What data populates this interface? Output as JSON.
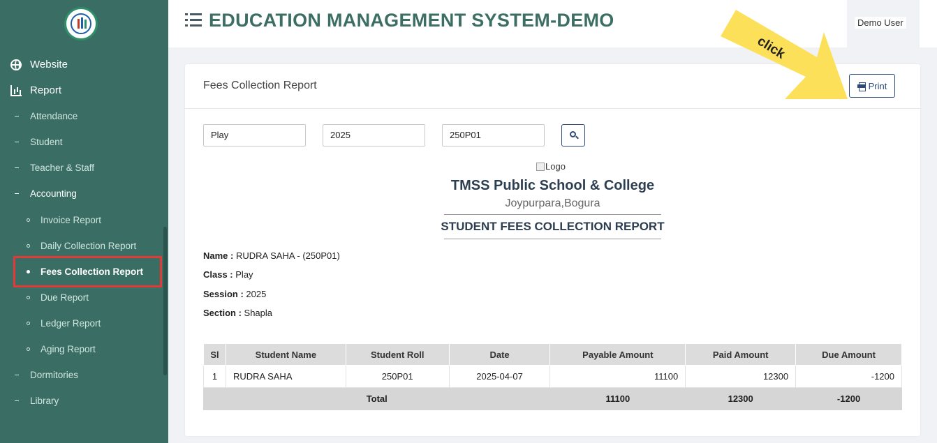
{
  "header": {
    "title": "EDUCATION MANAGEMENT SYSTEM-DEMO",
    "user": "Demo User"
  },
  "sidebar": {
    "top_items": [
      {
        "label": "Website",
        "icon": "globe-icon"
      },
      {
        "label": "Report",
        "icon": "bar-chart-icon"
      }
    ],
    "report_items": [
      {
        "label": "Attendance"
      },
      {
        "label": "Student"
      },
      {
        "label": "Teacher & Staff"
      },
      {
        "label": "Accounting"
      }
    ],
    "accounting_items": [
      {
        "label": "Invoice Report"
      },
      {
        "label": "Daily Collection Report"
      },
      {
        "label": "Fees Collection Report",
        "active": true
      },
      {
        "label": "Due Report"
      },
      {
        "label": "Ledger Report"
      },
      {
        "label": "Aging Report"
      }
    ],
    "bottom_items": [
      {
        "label": "Dormitories"
      },
      {
        "label": "Library"
      }
    ]
  },
  "card": {
    "title": "Fees Collection Report",
    "print_label": "Print"
  },
  "filters": {
    "class": "Play",
    "session": "2025",
    "student": "250P01"
  },
  "report": {
    "logo_alt": "Logo",
    "school_name": "TMSS Public School & College",
    "address": "Joypurpara,Bogura",
    "title": "STUDENT FEES COLLECTION REPORT",
    "info": {
      "name_label": "Name :",
      "name_value": "RUDRA SAHA - (250P01)",
      "class_label": "Class :",
      "class_value": "Play",
      "session_label": "Session :",
      "session_value": "2025",
      "section_label": "Section :",
      "section_value": "Shapla"
    }
  },
  "table": {
    "columns": [
      "Sl",
      "Student Name",
      "Student Roll",
      "Date",
      "Payable Amount",
      "Paid Amount",
      "Due Amount"
    ],
    "rows": [
      [
        "1",
        "RUDRA SAHA",
        "250P01",
        "2025-04-07",
        "11100",
        "12300",
        "-1200"
      ]
    ],
    "total": {
      "label": "Total",
      "payable": "11100",
      "paid": "12300",
      "due": "-1200"
    }
  },
  "annotation": {
    "text": "click",
    "color": "#fde05a"
  }
}
